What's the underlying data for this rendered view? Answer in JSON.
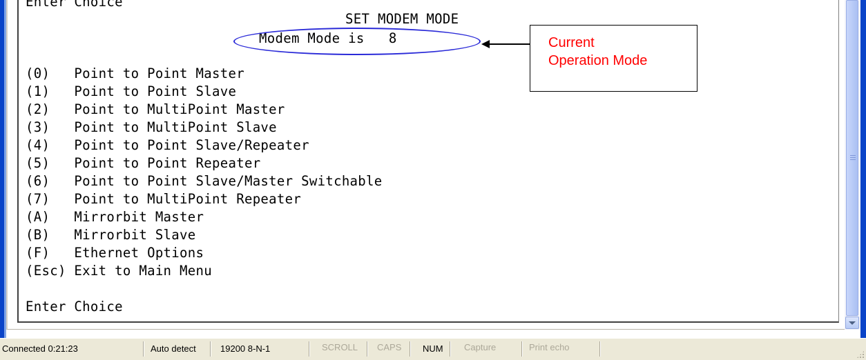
{
  "terminal": {
    "top_partial": "Enter Choice",
    "title": "SET MODEM MODE",
    "mode_line": "Modem Mode is   8",
    "options": [
      "(0)   Point to Point Master",
      "(1)   Point to Point Slave",
      "(2)   Point to MultiPoint Master",
      "(3)   Point to MultiPoint Slave",
      "(4)   Point to Point Slave/Repeater",
      "(5)   Point to Point Repeater",
      "(6)   Point to Point Slave/Master Switchable",
      "(7)   Point to MultiPoint Repeater",
      "(A)   Mirrorbit Master",
      "(B)   Mirrorbit Slave",
      "(F)   Ethernet Options",
      "(Esc) Exit to Main Menu"
    ],
    "prompt": "Enter Choice"
  },
  "annotation": {
    "line1": "Current",
    "line2": "Operation Mode",
    "color": "#ff0000",
    "ellipse_color": "#2a2ad8"
  },
  "statusbar": {
    "connected": "Connected 0:21:23",
    "detect": "Auto detect",
    "port": "19200 8-N-1",
    "scroll": "SCROLL",
    "caps": "CAPS",
    "num": "NUM",
    "capture": "Capture",
    "print_echo": "Print echo"
  }
}
